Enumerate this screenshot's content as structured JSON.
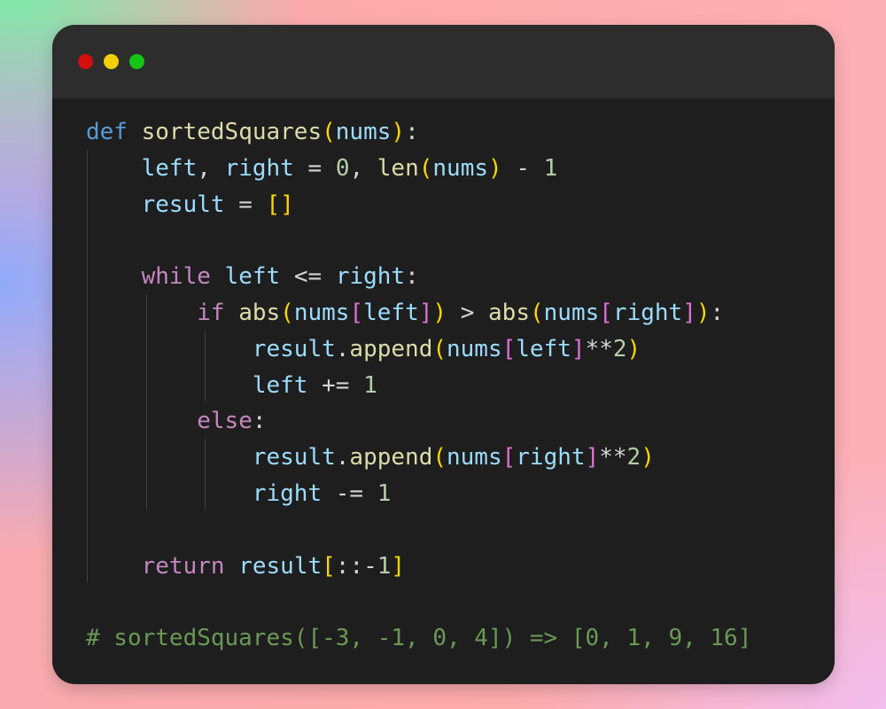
{
  "window": {
    "controls": {
      "close": "close-dot",
      "minimize": "minimize-dot",
      "maximize": "maximize-dot"
    }
  },
  "code": {
    "language": "python",
    "lines": [
      "def sortedSquares(nums):",
      "    left, right = 0, len(nums) - 1",
      "    result = []",
      "",
      "    while left <= right:",
      "        if abs(nums[left]) > abs(nums[right]):",
      "            result.append(nums[left]**2)",
      "            left += 1",
      "        else:",
      "            result.append(nums[right]**2)",
      "            right -= 1",
      "",
      "    return result[::-1]",
      "",
      "# sortedSquares([-3, -1, 0, 4]) => [0, 1, 9, 16]"
    ]
  },
  "colors": {
    "background_window": "#1e1e1e",
    "titlebar": "#2d2d2d",
    "keyword_def": "#569cd6",
    "keyword_control": "#c586c0",
    "function": "#dcdcaa",
    "variable": "#9cdcfe",
    "number": "#b5cea8",
    "bracket_1": "#ffd700",
    "bracket_2": "#da70d6",
    "comment": "#6a9955",
    "close_dot": "#d10f0f",
    "minimize_dot": "#f2cf0a",
    "maximize_dot": "#16c516"
  }
}
